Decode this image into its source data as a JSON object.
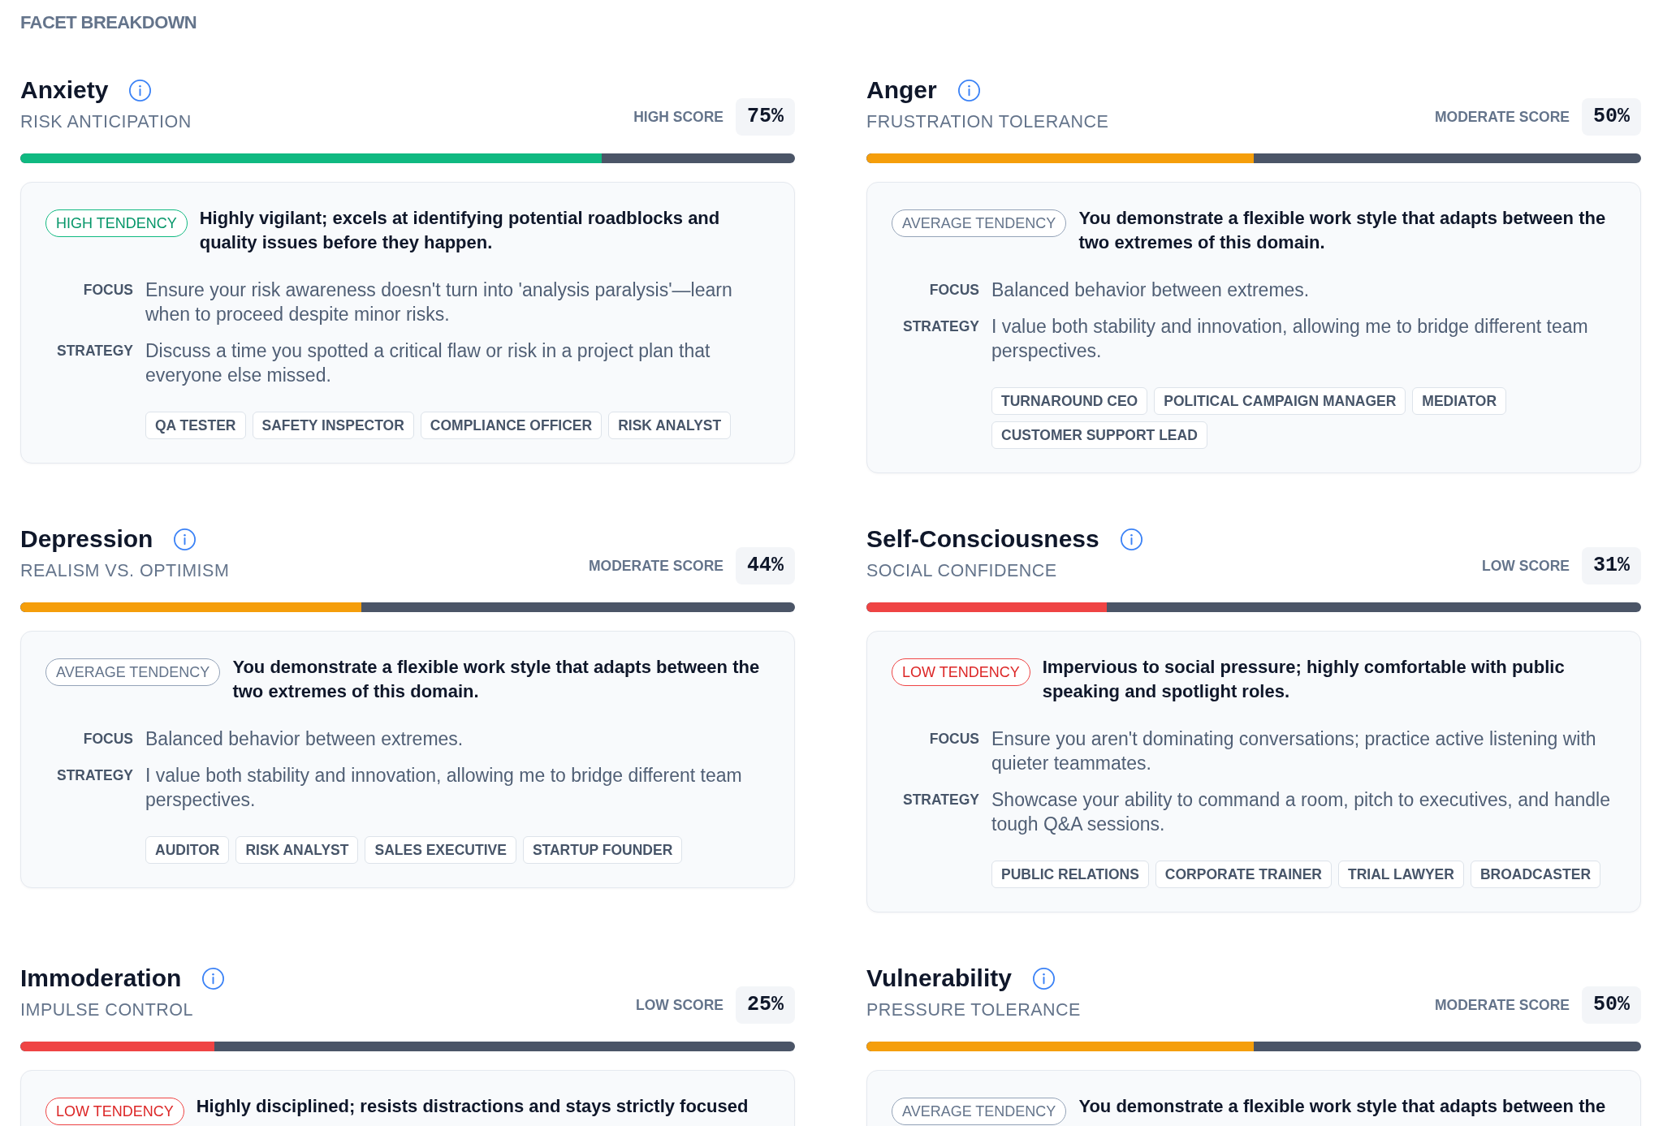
{
  "section_title": "FACET BREAKDOWN",
  "facets": [
    {
      "name": "Anxiety",
      "subtitle": "RISK ANTICIPATION",
      "kind": "high",
      "score_label": "HIGH SCORE",
      "score": "75%",
      "level": 0.75,
      "tendency": "HIGH TENDENCY",
      "summary": "Highly vigilant; excels at identifying potential roadblocks and quality issues before they happen.",
      "details": [
        {
          "label": "FOCUS",
          "text": "Ensure your risk awareness doesn't turn into 'analysis paralysis'—learn when to proceed despite minor risks."
        },
        {
          "label": "STRATEGY",
          "text": "Discuss a time you spotted a critical flaw or risk in a project plan that everyone else missed."
        }
      ],
      "roles": [
        "QA TESTER",
        "SAFETY INSPECTOR",
        "COMPLIANCE OFFICER",
        "RISK ANALYST"
      ]
    },
    {
      "name": "Anger",
      "subtitle": "FRUSTRATION TOLERANCE",
      "kind": "moderate",
      "score_label": "MODERATE SCORE",
      "score": "50%",
      "level": 0.5,
      "tendency": "AVERAGE TENDENCY",
      "summary": "You demonstrate a flexible work style that adapts between the two extremes of this domain.",
      "details": [
        {
          "label": "FOCUS",
          "text": "Balanced behavior between extremes."
        },
        {
          "label": "STRATEGY",
          "text": "I value both stability and innovation, allowing me to bridge different team perspectives."
        }
      ],
      "roles": [
        "TURNAROUND CEO",
        "POLITICAL CAMPAIGN MANAGER",
        "MEDIATOR",
        "CUSTOMER SUPPORT LEAD"
      ]
    },
    {
      "name": "Depression",
      "subtitle": "REALISM VS. OPTIMISM",
      "kind": "moderate",
      "score_label": "MODERATE SCORE",
      "score": "44%",
      "level": 0.44,
      "tendency": "AVERAGE TENDENCY",
      "summary": "You demonstrate a flexible work style that adapts between the two extremes of this domain.",
      "details": [
        {
          "label": "FOCUS",
          "text": "Balanced behavior between extremes."
        },
        {
          "label": "STRATEGY",
          "text": "I value both stability and innovation, allowing me to bridge different team perspectives."
        }
      ],
      "roles": [
        "AUDITOR",
        "RISK ANALYST",
        "SALES EXECUTIVE",
        "STARTUP FOUNDER"
      ]
    },
    {
      "name": "Self-Consciousness",
      "subtitle": "SOCIAL CONFIDENCE",
      "kind": "low",
      "score_label": "LOW SCORE",
      "score": "31%",
      "level": 0.31,
      "tendency": "LOW TENDENCY",
      "summary": "Impervious to social pressure; highly comfortable with public speaking and spotlight roles.",
      "details": [
        {
          "label": "FOCUS",
          "text": "Ensure you aren't dominating conversations; practice active listening with quieter teammates."
        },
        {
          "label": "STRATEGY",
          "text": "Showcase your ability to command a room, pitch to executives, and handle tough Q&A sessions."
        }
      ],
      "roles": [
        "PUBLIC RELATIONS",
        "CORPORATE TRAINER",
        "TRIAL LAWYER",
        "BROADCASTER"
      ]
    },
    {
      "name": "Immoderation",
      "subtitle": "IMPULSE CONTROL",
      "kind": "low",
      "score_label": "LOW SCORE",
      "score": "25%",
      "level": 0.25,
      "tendency": "LOW TENDENCY",
      "summary": "Highly disciplined; resists distractions and stays strictly focused"
    },
    {
      "name": "Vulnerability",
      "subtitle": "PRESSURE TOLERANCE",
      "kind": "moderate",
      "score_label": "MODERATE SCORE",
      "score": "50%",
      "level": 0.5,
      "tendency": "AVERAGE TENDENCY",
      "summary": "You demonstrate a flexible work style that adapts between the"
    }
  ]
}
